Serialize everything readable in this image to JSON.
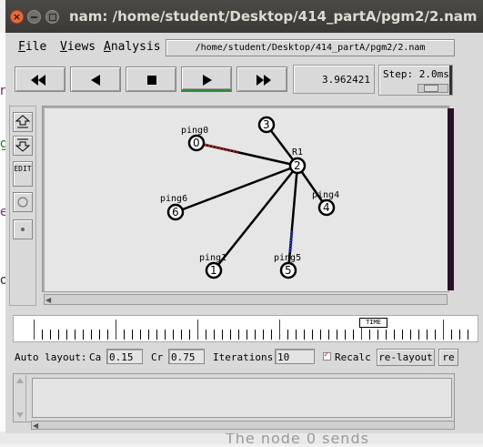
{
  "window": {
    "title": "nam: /home/student/Desktop/414_partA/pgm2/2.nam"
  },
  "menubar": {
    "file": "File",
    "views": "Views",
    "analysis": "Analysis",
    "path": "/home/student/Desktop/414_partA/pgm2/2.nam"
  },
  "controls": {
    "rewind_icon": "fast-rewind-icon",
    "back_icon": "play-backward-icon",
    "stop_icon": "stop-icon",
    "play_icon": "play-forward-icon",
    "ff_icon": "fast-forward-icon",
    "time": "3.962421",
    "step_label": "Step: 2.0ms"
  },
  "lefttools": {
    "edit_label": "EDIT"
  },
  "topology": {
    "nodes": [
      {
        "id": "0",
        "label": "ping0"
      },
      {
        "id": "1",
        "label": "ping1"
      },
      {
        "id": "2",
        "label": "R1"
      },
      {
        "id": "3",
        "label": ""
      },
      {
        "id": "4",
        "label": "ping4"
      },
      {
        "id": "5",
        "label": "ping5"
      },
      {
        "id": "6",
        "label": "ping6"
      }
    ],
    "links": [
      [
        "0",
        "2"
      ],
      [
        "3",
        "2"
      ],
      [
        "6",
        "2"
      ],
      [
        "1",
        "2"
      ],
      [
        "5",
        "2"
      ],
      [
        "4",
        "2"
      ]
    ],
    "packet_colors": {
      "red": "#c81e1e",
      "blue": "#2030c8"
    }
  },
  "timeline": {
    "marker_label": "TIME"
  },
  "autolayout": {
    "label": "Auto layout:",
    "ca_label": "Ca",
    "ca_value": "0.15",
    "cr_label": "Cr",
    "cr_value": "0.75",
    "iterations_label": "Iterations",
    "iterations_value": "10",
    "recalc_label": "Recalc",
    "relayout_label": "re-layout",
    "reset_label": "re"
  },
  "desktop": {
    "bottom_text": "The node 0 sends"
  }
}
